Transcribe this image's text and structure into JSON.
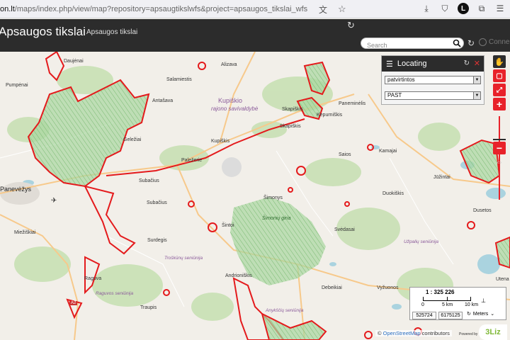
{
  "browser": {
    "url_host": "on.lt",
    "url_path": "/maps/index.php/view/map?repository=apsaugtikslwfs&project=apsaugos_tikslai_wfs",
    "avatar_letter": "L"
  },
  "app": {
    "title": "Apsaugos tikslai",
    "subtitle": "Apsaugos tikslai",
    "search_placeholder": "Search",
    "connect_label": "Connect"
  },
  "locating": {
    "title": "Locating",
    "select1_value": "patvirtintos",
    "select2_value": "PAST"
  },
  "map": {
    "places": [
      {
        "name": "Daujėnai",
        "cls": ""
      },
      {
        "name": "Pumpėnai",
        "cls": ""
      },
      {
        "name": "Salamiestis",
        "cls": ""
      },
      {
        "name": "Alizava",
        "cls": ""
      },
      {
        "name": "Antašava",
        "cls": ""
      },
      {
        "name": "Kupiškio",
        "cls": "big"
      },
      {
        "name": "rajono savivaldybė",
        "cls": "muni"
      },
      {
        "name": "Skapiškis",
        "cls": ""
      },
      {
        "name": "Kepurniškis",
        "cls": ""
      },
      {
        "name": "Paneminėlis",
        "cls": ""
      },
      {
        "name": "Kupiškis",
        "cls": ""
      },
      {
        "name": "Skapiškis",
        "cls": ""
      },
      {
        "name": "Saios",
        "cls": ""
      },
      {
        "name": "Kamajai",
        "cls": ""
      },
      {
        "name": "Geležiai",
        "cls": ""
      },
      {
        "name": "Paležerie",
        "cls": ""
      },
      {
        "name": "Subačius",
        "cls": ""
      },
      {
        "name": "Subačius",
        "cls": ""
      },
      {
        "name": "Panevėžys",
        "cls": "big"
      },
      {
        "name": "Šimonys",
        "cls": ""
      },
      {
        "name": "Šimonių giria",
        "cls": "forest"
      },
      {
        "name": "Duokiškis",
        "cls": ""
      },
      {
        "name": "Jūžintai",
        "cls": ""
      },
      {
        "name": "Miežiškiai",
        "cls": ""
      },
      {
        "name": "Šintoi",
        "cls": ""
      },
      {
        "name": "Svėdasai",
        "cls": ""
      },
      {
        "name": "Surdegis",
        "cls": ""
      },
      {
        "name": "Dusetos",
        "cls": ""
      },
      {
        "name": "Andrioniškis",
        "cls": ""
      },
      {
        "name": "Debeikiai",
        "cls": ""
      },
      {
        "name": "Vyžuonos",
        "cls": ""
      },
      {
        "name": "Raguva",
        "cls": ""
      },
      {
        "name": "Traupis",
        "cls": ""
      },
      {
        "name": "Utena",
        "cls": ""
      },
      {
        "name": "Užpalių seniūnija",
        "cls": "muni"
      },
      {
        "name": "Anykščių seniūnija",
        "cls": "muni"
      },
      {
        "name": "Raguvos seniūnija",
        "cls": "muni"
      },
      {
        "name": "Troškūnų seniūnija",
        "cls": "muni"
      },
      {
        "name": "A2",
        "cls": ""
      }
    ]
  },
  "scale": {
    "ratio": "1 : 325 226",
    "label0": "0",
    "label1": "5 km",
    "label2": "10 km",
    "coord_x": "525724",
    "coord_y": "6175125",
    "units": "Meters"
  },
  "attribution": {
    "prefix": "©",
    "osm": "OpenStreetMap",
    "suffix": "contributors",
    "powered": "Powered by",
    "logo": "3Liz"
  },
  "colors": {
    "header": "#2c2c2c",
    "accent_red": "#e8222a",
    "protected_fill": "#8fd29b"
  }
}
